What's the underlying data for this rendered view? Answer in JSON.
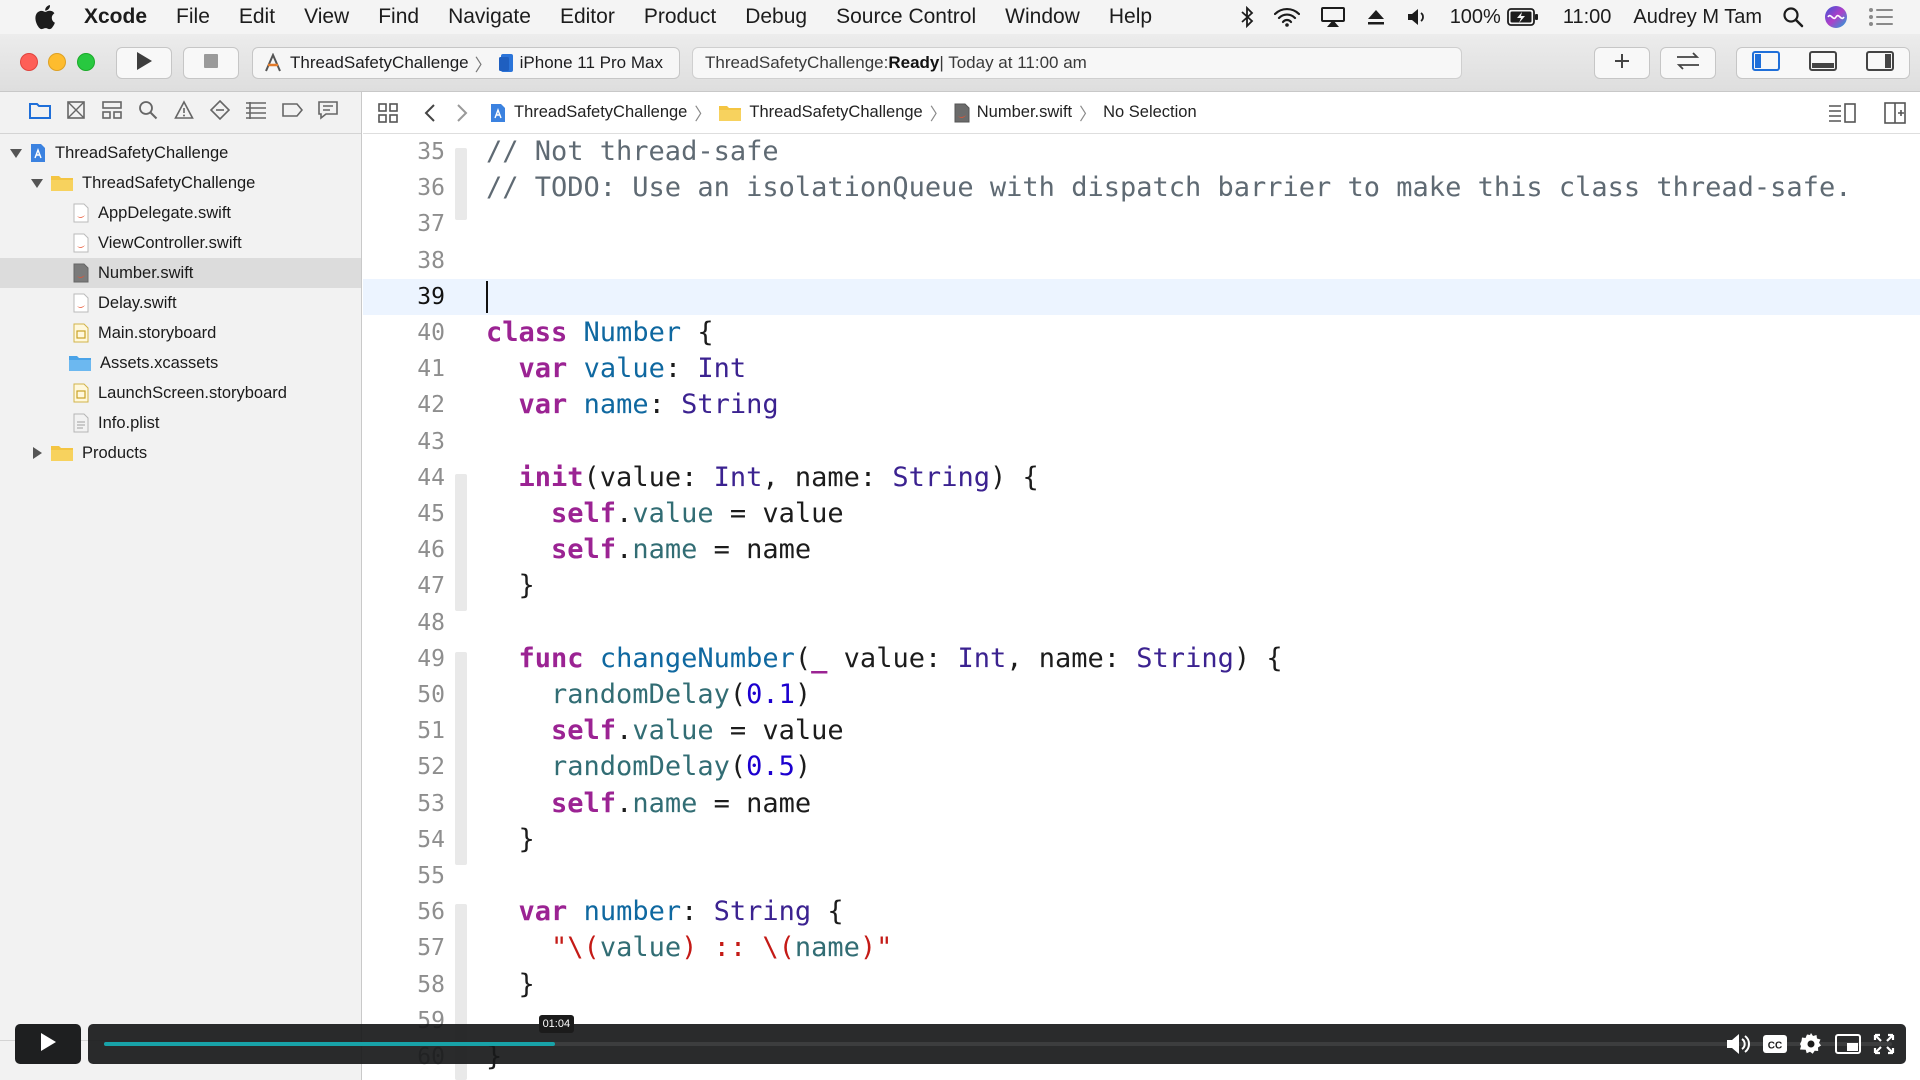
{
  "menubar": {
    "app_name": "Xcode",
    "items": [
      "File",
      "Edit",
      "View",
      "Find",
      "Navigate",
      "Editor",
      "Product",
      "Debug",
      "Source Control",
      "Window",
      "Help"
    ],
    "battery": "100%",
    "clock": "11:00",
    "user": "Audrey M Tam"
  },
  "toolbar": {
    "scheme": "ThreadSafetyChallenge",
    "device": "iPhone 11 Pro Max",
    "activity_project": "ThreadSafetyChallenge: ",
    "activity_status": "Ready",
    "activity_time": " | Today at 11:00 am"
  },
  "navigator": {
    "tree": [
      {
        "label": "ThreadSafetyChallenge",
        "kind": "project",
        "depth": 0,
        "disclosure": "open"
      },
      {
        "label": "ThreadSafetyChallenge",
        "kind": "folder",
        "depth": 1,
        "disclosure": "open"
      },
      {
        "label": "AppDelegate.swift",
        "kind": "swift",
        "depth": 2
      },
      {
        "label": "ViewController.swift",
        "kind": "swift",
        "depth": 2
      },
      {
        "label": "Number.swift",
        "kind": "swift",
        "depth": 2,
        "selected": true
      },
      {
        "label": "Delay.swift",
        "kind": "swift",
        "depth": 2
      },
      {
        "label": "Main.storyboard",
        "kind": "storyboard",
        "depth": 2
      },
      {
        "label": "Assets.xcassets",
        "kind": "assets",
        "depth": 2
      },
      {
        "label": "LaunchScreen.storyboard",
        "kind": "storyboard",
        "depth": 2
      },
      {
        "label": "Info.plist",
        "kind": "plist",
        "depth": 2
      },
      {
        "label": "Products",
        "kind": "folder",
        "depth": 1,
        "disclosure": "closed"
      }
    ]
  },
  "jumpbar": {
    "project": "ThreadSafetyChallenge",
    "group": "ThreadSafetyChallenge",
    "file": "Number.swift",
    "selection": "No Selection"
  },
  "editor": {
    "current_line": 39,
    "lines": [
      {
        "n": 35,
        "tokens": [
          [
            "cm",
            "// Not thread-safe"
          ]
        ]
      },
      {
        "n": 36,
        "tokens": [
          [
            "cm",
            "// TODO: Use an isolationQueue with dispatch barrier to make this class thread-safe."
          ]
        ]
      },
      {
        "n": 37,
        "tokens": []
      },
      {
        "n": 38,
        "tokens": []
      },
      {
        "n": 39,
        "tokens": []
      },
      {
        "n": 40,
        "tokens": [
          [
            "kw",
            "class"
          ],
          [
            "p",
            " "
          ],
          [
            "dcl",
            "Number"
          ],
          [
            "p",
            " {"
          ]
        ]
      },
      {
        "n": 41,
        "tokens": [
          [
            "p",
            "  "
          ],
          [
            "kw",
            "var"
          ],
          [
            "p",
            " "
          ],
          [
            "dcl",
            "value"
          ],
          [
            "p",
            ": "
          ],
          [
            "ty",
            "Int"
          ]
        ]
      },
      {
        "n": 42,
        "tokens": [
          [
            "p",
            "  "
          ],
          [
            "kw",
            "var"
          ],
          [
            "p",
            " "
          ],
          [
            "dcl",
            "name"
          ],
          [
            "p",
            ": "
          ],
          [
            "ty",
            "String"
          ]
        ]
      },
      {
        "n": 43,
        "tokens": []
      },
      {
        "n": 44,
        "tokens": [
          [
            "p",
            "  "
          ],
          [
            "kw",
            "init"
          ],
          [
            "p",
            "(value: "
          ],
          [
            "ty",
            "Int"
          ],
          [
            "p",
            ", name: "
          ],
          [
            "ty",
            "String"
          ],
          [
            "p",
            ") {"
          ]
        ]
      },
      {
        "n": 45,
        "tokens": [
          [
            "p",
            "    "
          ],
          [
            "kw",
            "self"
          ],
          [
            "p",
            "."
          ],
          [
            "ref",
            "value"
          ],
          [
            "p",
            " = value"
          ]
        ]
      },
      {
        "n": 46,
        "tokens": [
          [
            "p",
            "    "
          ],
          [
            "kw",
            "self"
          ],
          [
            "p",
            "."
          ],
          [
            "ref",
            "name"
          ],
          [
            "p",
            " = name"
          ]
        ]
      },
      {
        "n": 47,
        "tokens": [
          [
            "p",
            "  }"
          ]
        ]
      },
      {
        "n": 48,
        "tokens": []
      },
      {
        "n": 49,
        "tokens": [
          [
            "p",
            "  "
          ],
          [
            "kw",
            "func"
          ],
          [
            "p",
            " "
          ],
          [
            "dcl",
            "changeNumber"
          ],
          [
            "p",
            "("
          ],
          [
            "kw",
            "_"
          ],
          [
            "p",
            " value: "
          ],
          [
            "ty",
            "Int"
          ],
          [
            "p",
            ", name: "
          ],
          [
            "ty",
            "String"
          ],
          [
            "p",
            ") {"
          ]
        ]
      },
      {
        "n": 50,
        "tokens": [
          [
            "p",
            "    "
          ],
          [
            "ref",
            "randomDelay"
          ],
          [
            "p",
            "("
          ],
          [
            "num",
            "0.1"
          ],
          [
            "p",
            ")"
          ]
        ]
      },
      {
        "n": 51,
        "tokens": [
          [
            "p",
            "    "
          ],
          [
            "kw",
            "self"
          ],
          [
            "p",
            "."
          ],
          [
            "ref",
            "value"
          ],
          [
            "p",
            " = value"
          ]
        ]
      },
      {
        "n": 52,
        "tokens": [
          [
            "p",
            "    "
          ],
          [
            "ref",
            "randomDelay"
          ],
          [
            "p",
            "("
          ],
          [
            "num",
            "0.5"
          ],
          [
            "p",
            ")"
          ]
        ]
      },
      {
        "n": 53,
        "tokens": [
          [
            "p",
            "    "
          ],
          [
            "kw",
            "self"
          ],
          [
            "p",
            "."
          ],
          [
            "ref",
            "name"
          ],
          [
            "p",
            " = name"
          ]
        ]
      },
      {
        "n": 54,
        "tokens": [
          [
            "p",
            "  }"
          ]
        ]
      },
      {
        "n": 55,
        "tokens": []
      },
      {
        "n": 56,
        "tokens": [
          [
            "p",
            "  "
          ],
          [
            "kw",
            "var"
          ],
          [
            "p",
            " "
          ],
          [
            "dcl",
            "number"
          ],
          [
            "p",
            ": "
          ],
          [
            "ty",
            "String"
          ],
          [
            "p",
            " {"
          ]
        ]
      },
      {
        "n": 57,
        "tokens": [
          [
            "p",
            "    "
          ],
          [
            "str",
            "\"\\("
          ],
          [
            "ref",
            "value"
          ],
          [
            "str",
            ") :: \\("
          ],
          [
            "ref",
            "name"
          ],
          [
            "str",
            ")\""
          ]
        ]
      },
      {
        "n": 58,
        "tokens": [
          [
            "p",
            "  }"
          ]
        ]
      },
      {
        "n": 59,
        "tokens": []
      },
      {
        "n": 60,
        "tokens": [
          [
            "p",
            "}"
          ]
        ]
      }
    ]
  },
  "player": {
    "time_tooltip": "01:04",
    "progress": 0.252,
    "accent": "#18a2a8"
  },
  "colors": {
    "keyword": "#9b2393",
    "type": "#3b2290",
    "declaration": "#0f68a0",
    "reference": "#326d74",
    "number": "#1c00cf",
    "string": "#c41a16",
    "comment": "#5f6a73",
    "current_line_bg": "#ecf4ff"
  }
}
